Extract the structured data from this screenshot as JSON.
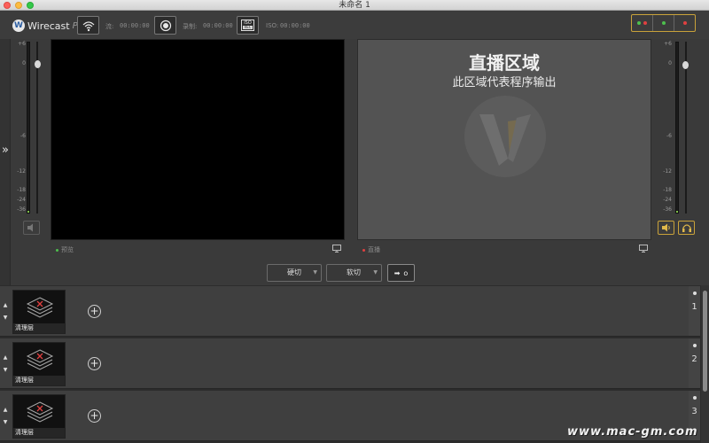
{
  "window": {
    "title": "未命名 1"
  },
  "app": {
    "brand_letter": "W",
    "name": "Wirecast",
    "edition": "Pro"
  },
  "toolbar": {
    "stream_label": "流:",
    "stream_time": "00:00:00",
    "record_label": "录制:",
    "record_time": "00:00:00",
    "iso_label": "ISO:",
    "iso_time": "00:00:00",
    "iso_badge_top": "ISO",
    "iso_badge_bottom": "REC"
  },
  "status_colors": {
    "red": "#e04040",
    "green": "#4ec04e",
    "accent": "#c9a23a"
  },
  "meter_scale": [
    "+6",
    "0",
    "-6",
    "-12",
    "-18",
    "-24",
    "-36"
  ],
  "expand_glyph": "»",
  "preview": {
    "label": "预览"
  },
  "live": {
    "label": "直播",
    "title": "直播区域",
    "subtitle": "此区域代表程序输出"
  },
  "transitions": {
    "cut": "硬切",
    "smooth": "软切",
    "go_glyph": "➡",
    "go_label": "o"
  },
  "layers": [
    {
      "number": "1",
      "shot_label": "清理层"
    },
    {
      "number": "2",
      "shot_label": "清理层"
    },
    {
      "number": "3",
      "shot_label": "清理层"
    }
  ],
  "watermark": "www.mac-gm.com"
}
